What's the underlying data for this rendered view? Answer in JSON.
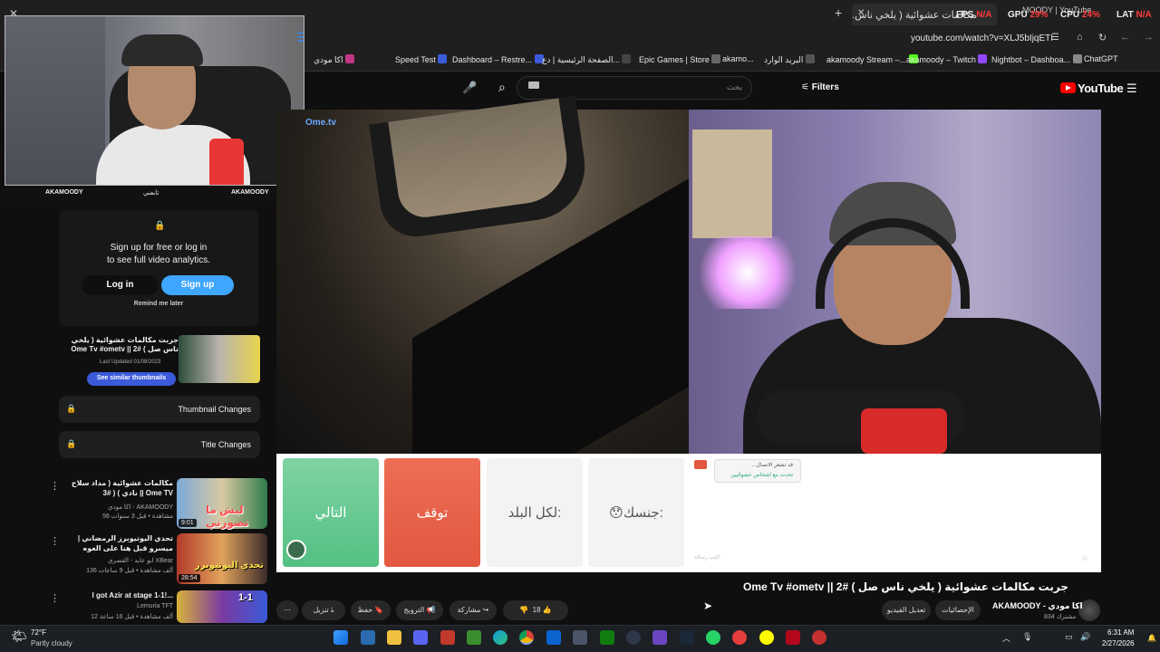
{
  "browser": {
    "tab_title": "مكالمات عشوائية ( يلخي ناس... ",
    "tab2_title": "MOODY | YouTube",
    "perf": {
      "fps": "FPS",
      "fps_val": "N/A",
      "gpu": "GPU",
      "gpu_val": "29%",
      "cpu": "CPU",
      "cpu_val": "24%",
      "lat": "LAT",
      "lat_val": "N/A"
    },
    "url": "youtube.com/watch?v=XLJ5bIjqETI",
    "bookmarks": [
      "اكا مودي",
      "Speed Test",
      "Dashboard – Restre...",
      "الصفحة الرئيسية | دع...",
      "Epic Games | Store",
      "akamo...",
      "البريد الوارد",
      "akamoody Stream –...",
      "akamoody – Twitch",
      "Nightbot – Dashboa...",
      "ChatGPT"
    ]
  },
  "youtube": {
    "logo": "YouTube",
    "search_placeholder": "بحث",
    "filters_label": "Filters"
  },
  "webcam": {
    "footer_left": "AKAMOODY",
    "footer_mid": "تابعني",
    "footer_right": "AKAMOODY"
  },
  "analytics": {
    "title_line1": "Sign up for free or log in",
    "title_line2": "to see full video analytics.",
    "login": "Log in",
    "signup": "Sign up",
    "remind": "Remind me later",
    "thumb_title": "جربت مكالمات عشوائية ( يلخي ناس صل ) #2 || Ome Tv #ometv",
    "last_updated": "Last Updated 01/08/2023",
    "similar_btn": "See similar thumbnails",
    "thumbnail_changes": "Thumbnail Changes",
    "title_changes": "Title Changes"
  },
  "ometv": {
    "brand": "Ome.tv",
    "next": "التالي",
    "stop": "توقف",
    "country": "لكل البلد:",
    "gender": "جنسك:",
    "chat_line1": "...قد تشعر الاتصال",
    "chat_line2": "تحدث مع اشخاص عشوائيين",
    "chat_placeholder": "اكتب رسالة"
  },
  "video": {
    "title": "جربت مكالمات عشوائية ( يلخي ناس صل ) #2 || Ome Tv #ometv",
    "channel": "AKAMOODY - اكا مودي",
    "subs": "834 مشترك",
    "btn_analytics": "الإحصائيات",
    "btn_edit": "تعديل الفيديو",
    "likes": "18",
    "share": "مشاركة",
    "clip": "الترويج",
    "save": "حفظ",
    "download": "تنزيل"
  },
  "related": [
    {
      "title": "مكالمات عشوائية ( مداد سلاح نادي ) ( #3 || Ome TV",
      "channel": "اكا مودي - AKAMOODY",
      "meta": "56 مشاهدة • قبل 3 سنوات",
      "duration": "9:01",
      "thumb_text": "ليش ما تصورني"
    },
    {
      "title": "تحدي اليوتيوبرز الرمضاني | ميسرو قبل هنا على العوه",
      "channel": "ابو عابد - القصري XBear",
      "meta": "136 ألف مشاهدة • قبل 9 ساعات",
      "duration": "28:54",
      "thumb_text": "تحدي اليوتيوبرز"
    },
    {
      "title": "I got Azir at stage 1-1!...",
      "channel": "Lemuria TFT",
      "meta": "12 ألف مشاهدة • قبل 16 ساعة",
      "duration": "",
      "thumb_text": "1-1"
    }
  ],
  "taskbar": {
    "weather_temp": "72°F",
    "weather_desc": "Partly cloudy",
    "time": "6:31 AM",
    "date": "2/27/2026"
  }
}
